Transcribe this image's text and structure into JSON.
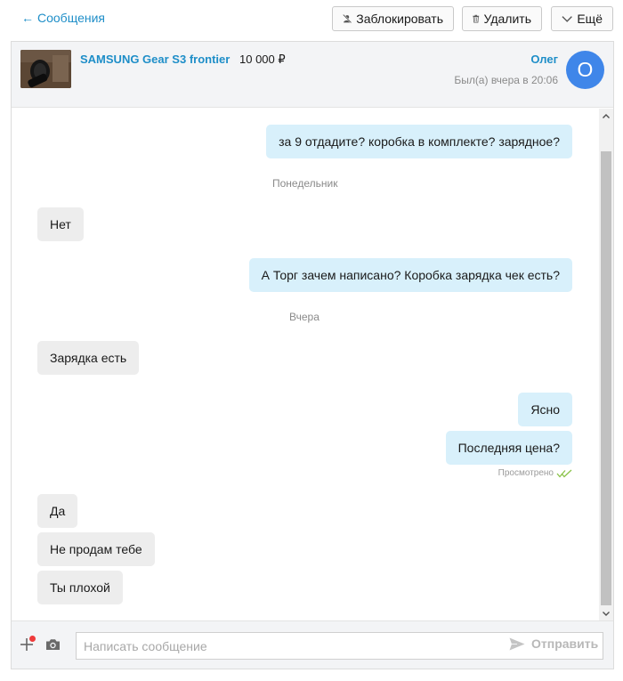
{
  "topbar": {
    "back_label": "Сообщения",
    "block_label": "Заблокировать",
    "delete_label": "Удалить",
    "more_label": "Ещё"
  },
  "header": {
    "item_title": "SAMSUNG Gear S3 frontier",
    "item_price": "10 000 ₽",
    "user_name": "Олег",
    "last_seen": "Был(а) вчера в 20:06",
    "avatar_letter": "О"
  },
  "messages": [
    {
      "dir": "out",
      "text": "за 9 отдадите? коробка в комплекте? зарядное?"
    },
    {
      "dir": "separator",
      "text": "Понедельник"
    },
    {
      "dir": "in",
      "text": "Нет"
    },
    {
      "dir": "out",
      "text": "А Торг зачем написано? Коробка зарядка чек есть?"
    },
    {
      "dir": "separator",
      "text": "Вчера"
    },
    {
      "dir": "in",
      "text": "Зарядка есть"
    },
    {
      "dir": "out",
      "text": "Ясно"
    },
    {
      "dir": "out",
      "text": "Последняя цена?"
    },
    {
      "dir": "in",
      "text": "Да"
    },
    {
      "dir": "in",
      "text": "Не продам тебе"
    },
    {
      "dir": "in",
      "text": "Ты плохой"
    }
  ],
  "read_receipt": "Просмотрено",
  "composer": {
    "placeholder": "Написать сообщение",
    "send_label": "Отправить"
  },
  "colors": {
    "accent": "#1e8ec8",
    "outgoing_bubble": "#d8f0fb",
    "incoming_bubble": "#ededed",
    "avatar": "#3f86e9",
    "notification_dot": "#ef3b3b",
    "read_check": "#8bc34a"
  },
  "icons": {
    "back": "arrow-left-icon",
    "block": "block-user-icon",
    "delete": "trash-icon",
    "more": "chevron-down-icon",
    "attach": "plus-icon",
    "camera": "camera-icon",
    "send": "send-icon",
    "read": "double-check-icon"
  }
}
